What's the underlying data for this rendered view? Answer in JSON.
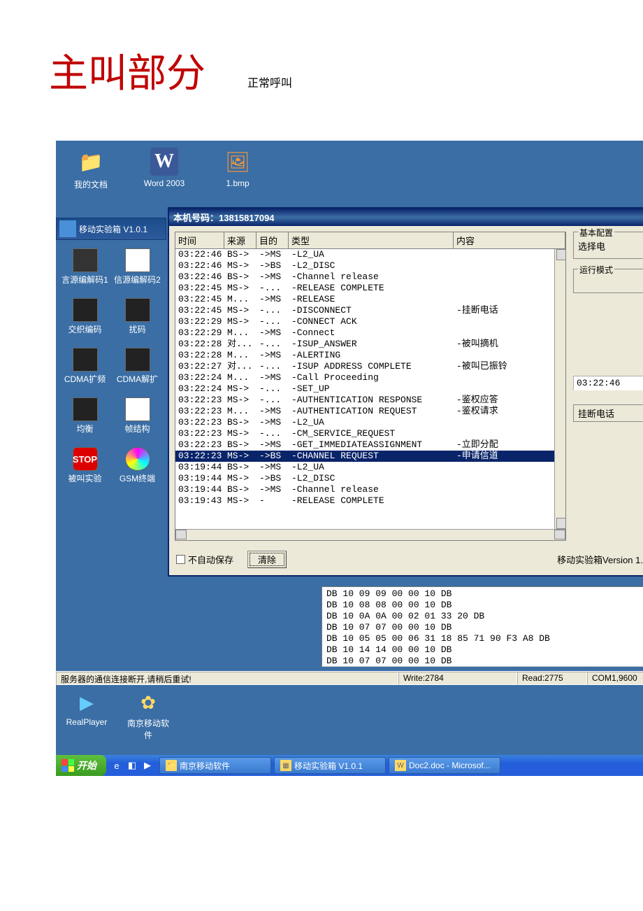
{
  "doc": {
    "title": "主叫部分",
    "subtitle": "正常呼叫"
  },
  "desktop": {
    "row1": [
      {
        "label": "我的文档",
        "icon": "📁"
      },
      {
        "label": "Word 2003",
        "icon": "W"
      },
      {
        "label": "1.bmp",
        "icon": "🖼"
      }
    ],
    "sidebar_title": "移动实验箱  V1.0.1",
    "sidebar_items": [
      {
        "label": "言源编解码1",
        "cls": "screen"
      },
      {
        "label": "信源编解码2",
        "cls": "net"
      },
      {
        "label": "交织编码",
        "cls": "dark"
      },
      {
        "label": "扰码",
        "cls": "dark"
      },
      {
        "label": "CDMA扩频",
        "cls": "dark"
      },
      {
        "label": "CDMA解扩",
        "cls": "dark"
      },
      {
        "label": "均衡",
        "cls": "hand"
      },
      {
        "label": "帧结构",
        "cls": "doc"
      },
      {
        "label": "被叫实验",
        "cls": "stop",
        "text": "STOP"
      },
      {
        "label": "GSM终端",
        "cls": "cd"
      }
    ],
    "row2": [
      {
        "label": "RealPlayer",
        "icon": "▶"
      },
      {
        "label": "南京移动软件",
        "icon": "✿"
      }
    ]
  },
  "window": {
    "title": "本机号码：13815817094",
    "columns": {
      "time": "时间",
      "src": "来源",
      "dst": "目的",
      "type": "类型",
      "content": "内容"
    },
    "rows": [
      {
        "t": "03:22:46",
        "s": "BS->",
        "d": "->MS",
        "y": "-L2_UA",
        "c": ""
      },
      {
        "t": "03:22:46",
        "s": "MS->",
        "d": "->BS",
        "y": "-L2_DISC",
        "c": ""
      },
      {
        "t": "03:22:46",
        "s": "BS->",
        "d": "->MS",
        "y": "-Channel release",
        "c": ""
      },
      {
        "t": "03:22:45",
        "s": "MS->",
        "d": "-...",
        "y": "-RELEASE COMPLETE",
        "c": ""
      },
      {
        "t": "03:22:45",
        "s": "M...",
        "d": "->MS",
        "y": "-RELEASE",
        "c": ""
      },
      {
        "t": "03:22:45",
        "s": "MS->",
        "d": "-...",
        "y": "-DISCONNECT",
        "c": "-挂断电话"
      },
      {
        "t": "03:22:29",
        "s": "MS->",
        "d": "-...",
        "y": "-CONNECT ACK",
        "c": ""
      },
      {
        "t": "03:22:29",
        "s": "M...",
        "d": "->MS",
        "y": "-Connect",
        "c": ""
      },
      {
        "t": "03:22:28",
        "s": "对...",
        "d": "-...",
        "y": "-ISUP_ANSWER",
        "c": "-被叫摘机"
      },
      {
        "t": "03:22:28",
        "s": "M...",
        "d": "->MS",
        "y": "-ALERTING",
        "c": ""
      },
      {
        "t": "03:22:27",
        "s": "对...",
        "d": "-...",
        "y": "-ISUP ADDRESS COMPLETE",
        "c": "-被叫已振铃"
      },
      {
        "t": "03:22:24",
        "s": "M...",
        "d": "->MS",
        "y": "-Call Proceeding",
        "c": ""
      },
      {
        "t": "03:22:24",
        "s": "MS->",
        "d": "-...",
        "y": "-SET_UP",
        "c": ""
      },
      {
        "t": "03:22:23",
        "s": "MS->",
        "d": "-...",
        "y": "-AUTHENTICATION RESPONSE",
        "c": "-鉴权应答"
      },
      {
        "t": "03:22:23",
        "s": "M...",
        "d": "->MS",
        "y": "-AUTHENTICATION REQUEST",
        "c": "-鉴权请求"
      },
      {
        "t": "03:22:23",
        "s": "BS->",
        "d": "->MS",
        "y": "-L2_UA",
        "c": ""
      },
      {
        "t": "03:22:23",
        "s": "MS->",
        "d": "-...",
        "y": "-CM_SERVICE_REQUEST",
        "c": ""
      },
      {
        "t": "03:22:23",
        "s": "BS->",
        "d": "->MS",
        "y": "-GET_IMMEDIATEASSIGNMENT",
        "c": "-立即分配"
      },
      {
        "t": "03:22:23",
        "s": "MS->",
        "d": "->BS",
        "y": "-CHANNEL REQUEST",
        "c": "-申请信道",
        "sel": true
      },
      {
        "t": "03:19:44",
        "s": "BS->",
        "d": "->MS",
        "y": "-L2_UA",
        "c": ""
      },
      {
        "t": "03:19:44",
        "s": "MS->",
        "d": "->BS",
        "y": "-L2_DISC",
        "c": ""
      },
      {
        "t": "03:19:44",
        "s": "BS->",
        "d": "->MS",
        "y": "-Channel release",
        "c": ""
      },
      {
        "t": "03:19:43",
        "s": "MS->",
        "d": "-",
        "y": "-RELEASE COMPLETE",
        "c": ""
      }
    ],
    "right": {
      "group1_title": "基本配置",
      "group1_row": "选择电",
      "group2_title": "运行模式",
      "timestamp": "03:22:46",
      "hangup": "挂断电话"
    },
    "bottom": {
      "check": "不自动保存",
      "clear": "清除",
      "version": "移动实验箱Version 1."
    }
  },
  "hex": "DB 10 09 09 00 00 10 DB\nDB 10 08 08 00 00 10 DB\nDB 10 0A 0A 00 02 01 33 20 DB\nDB 10 07 07 00 00 10 DB\nDB 10 05 05 00 06 31 18 85 71 90 F3 A8 DB\nDB 10 14 14 00 00 10 DB\nDB 10 07 07 00 00 10 DB",
  "status": {
    "msg": "服务器的通信连接断开,请稍后重试!",
    "write": "Write:2784",
    "read": "Read:2775",
    "com": "COM1,9600"
  },
  "taskbar": {
    "start": "开始",
    "buttons": [
      {
        "label": "南京移动软件",
        "icon": "📁"
      },
      {
        "label": "移动实验箱 V1.0.1",
        "icon": "▦"
      },
      {
        "label": "Doc2.doc - Microsof...",
        "icon": "W"
      }
    ]
  }
}
